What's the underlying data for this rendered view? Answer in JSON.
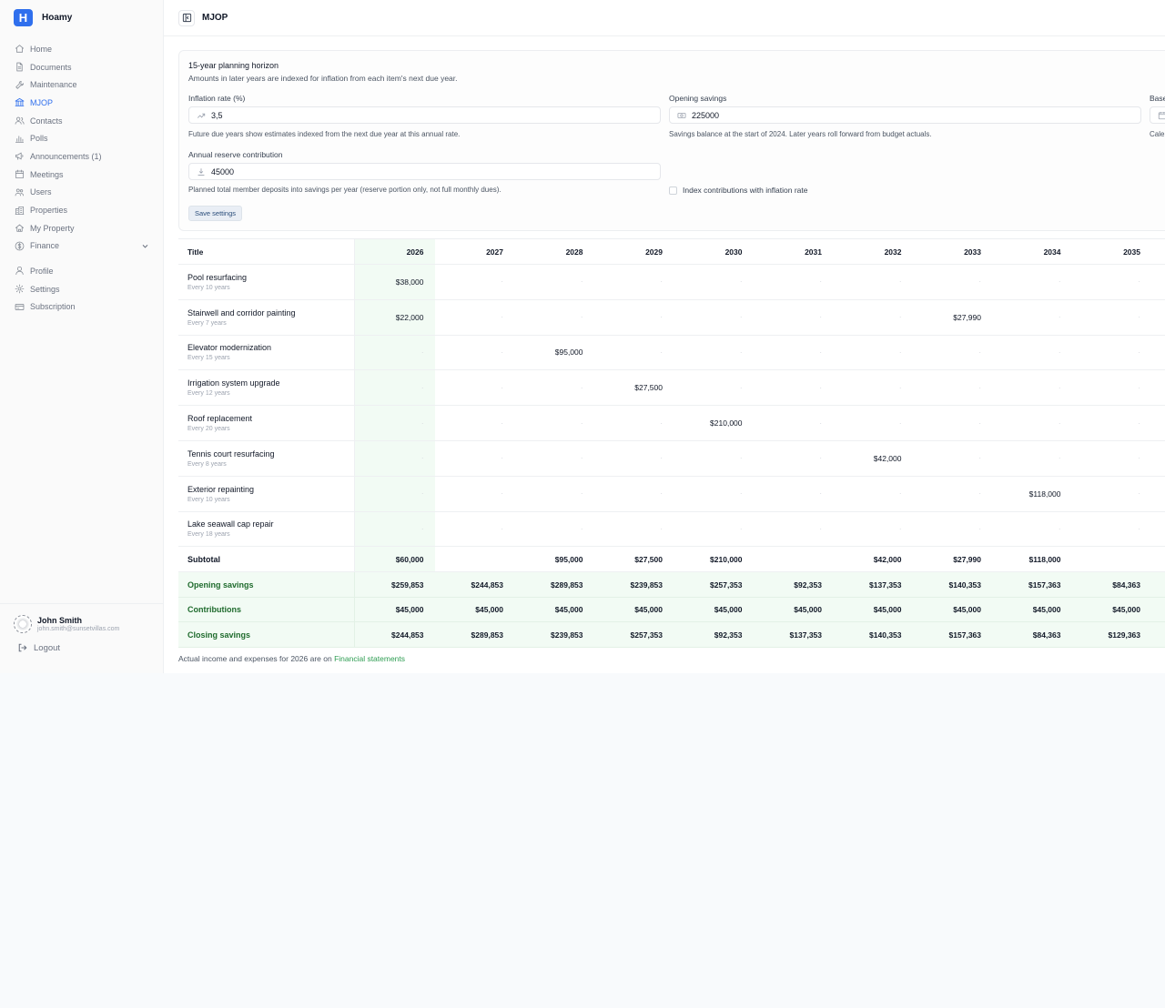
{
  "brand": {
    "logo_letter": "H",
    "name": "Hoamy"
  },
  "nav": [
    {
      "label": "Home",
      "icon": "home-icon"
    },
    {
      "label": "Documents",
      "icon": "document-icon"
    },
    {
      "label": "Maintenance",
      "icon": "wrench-icon"
    },
    {
      "label": "MJOP",
      "icon": "bank-icon",
      "active": true
    },
    {
      "label": "Contacts",
      "icon": "contacts-icon"
    },
    {
      "label": "Polls",
      "icon": "polls-icon"
    },
    {
      "label": "Announcements (1)",
      "icon": "megaphone-icon"
    },
    {
      "label": "Meetings",
      "icon": "calendar-icon"
    },
    {
      "label": "Users",
      "icon": "users-icon"
    },
    {
      "label": "Properties",
      "icon": "building-icon"
    },
    {
      "label": "My Property",
      "icon": "house-icon"
    },
    {
      "label": "Finance",
      "icon": "dollar-icon",
      "expandable": true
    }
  ],
  "nav_secondary": [
    {
      "label": "Profile",
      "icon": "user-icon"
    },
    {
      "label": "Settings",
      "icon": "gear-icon"
    },
    {
      "label": "Subscription",
      "icon": "card-icon"
    }
  ],
  "user": {
    "name": "John Smith",
    "email": "john.smith@sunsetvillas.com",
    "logout": "Logout"
  },
  "header": {
    "title": "MJOP"
  },
  "settings": {
    "title": "15-year planning horizon",
    "subtitle": "Amounts in later years are indexed for inflation from each item's next due year.",
    "inflation": {
      "label": "Inflation rate (%)",
      "value": "3,5",
      "hint": "Future due years show estimates indexed from the next due year at this annual rate."
    },
    "opening": {
      "label": "Opening savings",
      "value": "225000",
      "hint": "Savings balance at the start of 2024. Later years roll forward from budget actuals."
    },
    "base": {
      "label": "Base",
      "hint": "Cale"
    },
    "contribution": {
      "label": "Annual reserve contribution",
      "value": "45000",
      "hint": "Planned total member deposits into savings per year (reserve portion only, not full monthly dues)."
    },
    "index_checkbox": "Index contributions with inflation rate",
    "save": "Save settings"
  },
  "table": {
    "title_header": "Title",
    "current_year": "2026",
    "years": [
      "2026",
      "2027",
      "2028",
      "2029",
      "2030",
      "2031",
      "2032",
      "2033",
      "2034",
      "2035"
    ],
    "empty_mark": "·",
    "items": [
      {
        "name": "Pool resurfacing",
        "freq": "Every 10 years",
        "amounts": [
          "$38,000",
          "",
          "",
          "",
          "",
          "",
          "",
          "",
          "",
          ""
        ]
      },
      {
        "name": "Stairwell and corridor painting",
        "freq": "Every 7 years",
        "amounts": [
          "$22,000",
          "",
          "",
          "",
          "",
          "",
          "",
          "$27,990",
          "",
          ""
        ]
      },
      {
        "name": "Elevator modernization",
        "freq": "Every 15 years",
        "amounts": [
          "",
          "",
          "$95,000",
          "",
          "",
          "",
          "",
          "",
          "",
          ""
        ]
      },
      {
        "name": "Irrigation system upgrade",
        "freq": "Every 12 years",
        "amounts": [
          "",
          "",
          "",
          "$27,500",
          "",
          "",
          "",
          "",
          "",
          ""
        ]
      },
      {
        "name": "Roof replacement",
        "freq": "Every 20 years",
        "amounts": [
          "",
          "",
          "",
          "",
          "$210,000",
          "",
          "",
          "",
          "",
          ""
        ]
      },
      {
        "name": "Tennis court resurfacing",
        "freq": "Every 8 years",
        "amounts": [
          "",
          "",
          "",
          "",
          "",
          "",
          "$42,000",
          "",
          "",
          ""
        ]
      },
      {
        "name": "Exterior repainting",
        "freq": "Every 10 years",
        "amounts": [
          "",
          "",
          "",
          "",
          "",
          "",
          "",
          "",
          "$118,000",
          ""
        ]
      },
      {
        "name": "Lake seawall cap repair",
        "freq": "Every 18 years",
        "amounts": [
          "",
          "",
          "",
          "",
          "",
          "",
          "",
          "",
          "",
          ""
        ]
      }
    ],
    "subtotal": {
      "label": "Subtotal",
      "values": [
        "$60,000",
        "",
        "$95,000",
        "$27,500",
        "$210,000",
        "",
        "$42,000",
        "$27,990",
        "$118,000",
        ""
      ]
    },
    "summary": [
      {
        "label": "Opening savings",
        "values": [
          "$259,853",
          "$244,853",
          "$289,853",
          "$239,853",
          "$257,353",
          "$92,353",
          "$137,353",
          "$140,353",
          "$157,363",
          "$84,363"
        ]
      },
      {
        "label": "Contributions",
        "values": [
          "$45,000",
          "$45,000",
          "$45,000",
          "$45,000",
          "$45,000",
          "$45,000",
          "$45,000",
          "$45,000",
          "$45,000",
          "$45,000"
        ]
      },
      {
        "label": "Closing savings",
        "values": [
          "$244,853",
          "$289,853",
          "$239,853",
          "$257,353",
          "$92,353",
          "$137,353",
          "$140,353",
          "$157,363",
          "$84,363",
          "$129,363"
        ]
      }
    ]
  },
  "footer": {
    "text": "Actual income and expenses for 2026 are on ",
    "link": "Financial statements"
  },
  "colors": {
    "accent": "#2f6fed",
    "positive": "#2e7d3a",
    "highlight_bg": "#f2fbf4"
  }
}
